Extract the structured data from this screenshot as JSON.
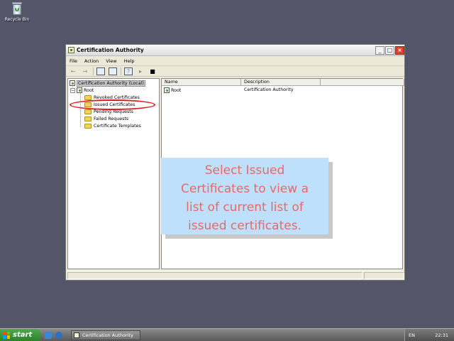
{
  "desktop": {
    "recycle_bin_label": "Recycle Bin"
  },
  "window": {
    "title": "Certification Authority",
    "menu": [
      "File",
      "Action",
      "View",
      "Help"
    ],
    "tree": {
      "root_label": "Certification Authority (Local)",
      "ca_label": "Root",
      "folders": [
        "Revoked Certificates",
        "Issued Certificates",
        "Pending Requests",
        "Failed Requests",
        "Certificate Templates"
      ]
    },
    "list": {
      "columns": [
        "Name",
        "Description"
      ],
      "rows": [
        {
          "name": "Root",
          "description": "Certification Authority"
        }
      ]
    }
  },
  "callout": {
    "lines": [
      "Select Issued",
      "Certificates to view a",
      "list of current list of",
      "issued certificates."
    ],
    "color": "#e36a6a",
    "background": "#bfe0fb"
  },
  "taskbar": {
    "start_label": "start",
    "task_label": "Certification Authority",
    "language": "EN",
    "clock": "22:31"
  }
}
